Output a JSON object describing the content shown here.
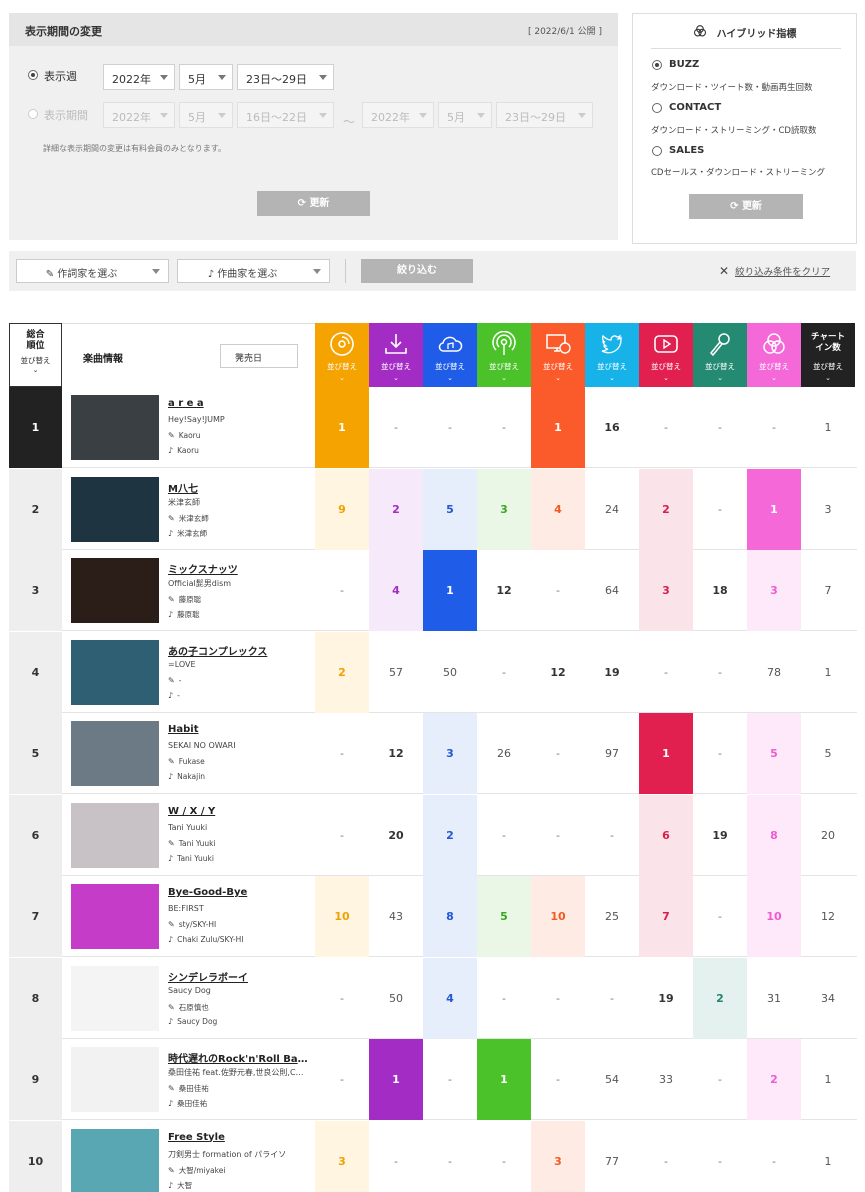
{
  "period": {
    "title": "表示期間の変更",
    "published": "[ 2022/6/1 公開 ]",
    "week_option_label": "表示週",
    "week": {
      "year": "2022年",
      "month": "5月",
      "range": "23日～29日"
    },
    "period_option_label": "表示期間",
    "range_from": {
      "year": "2022年",
      "month": "5月",
      "range": "16日～22日"
    },
    "range_sep": "～",
    "range_to": {
      "year": "2022年",
      "month": "5月",
      "range": "23日～29日"
    },
    "note": "詳細な表示期間の変更は有料会員のみとなります。",
    "update_label": "更新",
    "update_icon": "refresh-icon"
  },
  "hybrid": {
    "title": "ハイブリッド指標",
    "options": [
      {
        "label": "BUZZ",
        "desc": "ダウンロード・ツイート数・動画再生回数",
        "selected": true
      },
      {
        "label": "CONTACT",
        "desc": "ダウンロード・ストリーミング・CD読取数",
        "selected": false
      },
      {
        "label": "SALES",
        "desc": "CDセールス・ダウンロード・ストリーミング",
        "selected": false
      }
    ],
    "update_label": "更新"
  },
  "filter": {
    "lyricist_placeholder": "作詞家を選ぶ",
    "composer_placeholder": "作曲家を選ぶ",
    "apply_label": "絞り込む",
    "clear_label": "絞り込み条件をクリア"
  },
  "table": {
    "rank_header": "総合\n順位",
    "sort_label": "並び替え",
    "info_header": "楽曲情報",
    "release_sort": "発売日",
    "chart_in_header": "チャート\nイン数",
    "metrics": [
      {
        "key": "cd",
        "icon": "cd-icon",
        "color": "#f5a300",
        "light": "#fff5e0",
        "text": "#f0a000"
      },
      {
        "key": "download",
        "icon": "download-icon",
        "color": "#a32cc4",
        "light": "#f6e9f9",
        "text": "#a32cc4"
      },
      {
        "key": "streaming",
        "icon": "cloud-music-icon",
        "color": "#1f5de8",
        "light": "#e6eefc",
        "text": "#2456d8"
      },
      {
        "key": "radio",
        "icon": "radio-icon",
        "color": "#4cc22a",
        "light": "#eaf7e6",
        "text": "#3aa81e"
      },
      {
        "key": "pc",
        "icon": "pc-read-icon",
        "color": "#fb5a2a",
        "light": "#fdebe4",
        "text": "#f05a25"
      },
      {
        "key": "twitter",
        "icon": "twitter-icon",
        "color": "#17b3e8",
        "light": "#ffffff",
        "text": "#444444"
      },
      {
        "key": "youtube",
        "icon": "youtube-icon",
        "color": "#e2204f",
        "light": "#fbe3ea",
        "text": "#d81f4a"
      },
      {
        "key": "karaoke",
        "icon": "microphone-icon",
        "color": "#258a72",
        "light": "#e5f1ee",
        "text": "#238570"
      },
      {
        "key": "lookup",
        "icon": "hybrid-icon",
        "color": "#f468d8",
        "light": "#fde9f9",
        "text": "#ee5cd0"
      },
      {
        "key": "chartin",
        "icon": "",
        "color": "#222222",
        "light": "#ffffff",
        "text": "#555555"
      }
    ],
    "rows": [
      {
        "rank": "1",
        "title": "a r e a",
        "artist": "Hey!Say!JUMP",
        "lyricist": "Kaoru",
        "composer": "Kaoru",
        "cells": [
          "1",
          "-",
          "-",
          "-",
          "1",
          "16",
          "-",
          "-",
          "-",
          "1"
        ],
        "styles": [
          "S",
          "N",
          "N",
          "N",
          "S",
          "B",
          "N",
          "N",
          "N",
          "N"
        ],
        "thumb": "#3a3f44"
      },
      {
        "rank": "2",
        "title": "M八七",
        "artist": "米津玄師",
        "lyricist": "米津玄師",
        "composer": "米津玄師",
        "cells": [
          "9",
          "2",
          "5",
          "3",
          "4",
          "24",
          "2",
          "-",
          "1",
          "3"
        ],
        "styles": [
          "L",
          "L",
          "L",
          "L",
          "L",
          "N",
          "L",
          "N",
          "S",
          "N"
        ],
        "thumb": "#1e3440"
      },
      {
        "rank": "3",
        "title": "ミックスナッツ",
        "artist": "Official髭男dism",
        "lyricist": "藤原聡",
        "composer": "藤原聡",
        "cells": [
          "-",
          "4",
          "1",
          "12",
          "-",
          "64",
          "3",
          "18",
          "3",
          "7"
        ],
        "styles": [
          "N",
          "L",
          "S",
          "B",
          "N",
          "N",
          "L",
          "B",
          "L",
          "N"
        ],
        "thumb": "#2b1d18"
      },
      {
        "rank": "4",
        "title": "あの子コンプレックス",
        "artist": "=LOVE",
        "lyricist": "-",
        "composer": "-",
        "cells": [
          "2",
          "57",
          "50",
          "-",
          "12",
          "19",
          "-",
          "-",
          "78",
          "1"
        ],
        "styles": [
          "L",
          "N",
          "N",
          "N",
          "B",
          "B",
          "N",
          "N",
          "N",
          "N"
        ],
        "thumb": "#2f5f73"
      },
      {
        "rank": "5",
        "title": "Habit",
        "artist": "SEKAI NO OWARI",
        "lyricist": "Fukase",
        "composer": "Nakajin",
        "cells": [
          "-",
          "12",
          "3",
          "26",
          "-",
          "97",
          "1",
          "-",
          "5",
          "5"
        ],
        "styles": [
          "N",
          "B",
          "L",
          "N",
          "N",
          "N",
          "S",
          "N",
          "L",
          "N"
        ],
        "thumb": "#6c7a86"
      },
      {
        "rank": "6",
        "title": "W / X / Y",
        "artist": "Tani Yuuki",
        "lyricist": "Tani Yuuki",
        "composer": "Tani Yuuki",
        "cells": [
          "-",
          "20",
          "2",
          "-",
          "-",
          "-",
          "6",
          "19",
          "8",
          "20"
        ],
        "styles": [
          "N",
          "B",
          "L",
          "N",
          "N",
          "N",
          "L",
          "B",
          "L",
          "N"
        ],
        "thumb": "#c8c2c6"
      },
      {
        "rank": "7",
        "title": "Bye-Good-Bye",
        "artist": "BE:FIRST",
        "lyricist": "sty/SKY-HI",
        "composer": "Chaki Zulu/SKY-HI",
        "cells": [
          "10",
          "43",
          "8",
          "5",
          "10",
          "25",
          "7",
          "-",
          "10",
          "12"
        ],
        "styles": [
          "L",
          "N",
          "L",
          "L",
          "L",
          "N",
          "L",
          "N",
          "L",
          "N"
        ],
        "thumb": "#c43cc8"
      },
      {
        "rank": "8",
        "title": "シンデレラボーイ",
        "artist": "Saucy Dog",
        "lyricist": "石原慎也",
        "composer": "Saucy Dog",
        "cells": [
          "-",
          "50",
          "4",
          "-",
          "-",
          "-",
          "19",
          "2",
          "31",
          "34"
        ],
        "styles": [
          "N",
          "N",
          "L",
          "N",
          "N",
          "N",
          "B",
          "L",
          "N",
          "N"
        ],
        "thumb": "#f4f4f4"
      },
      {
        "rank": "9",
        "title": "時代遅れのRock'n'Roll Band",
        "artist": "桑田佳祐 feat.佐野元春,世良公則,Char,野口五郎",
        "lyricist": "桑田佳祐",
        "composer": "桑田佳祐",
        "cells": [
          "-",
          "1",
          "-",
          "1",
          "-",
          "54",
          "33",
          "-",
          "2",
          "1"
        ],
        "styles": [
          "N",
          "S",
          "N",
          "S",
          "N",
          "N",
          "N",
          "N",
          "L",
          "N"
        ],
        "thumb": "#f2f2f2"
      },
      {
        "rank": "10",
        "title": "Free Style",
        "artist": "刀剣男士 formation of パライソ",
        "lyricist": "大智/miyakei",
        "composer": "大智",
        "cells": [
          "3",
          "-",
          "-",
          "-",
          "3",
          "77",
          "-",
          "-",
          "-",
          "1"
        ],
        "styles": [
          "L",
          "N",
          "N",
          "N",
          "L",
          "N",
          "N",
          "N",
          "N",
          "N"
        ],
        "thumb": "#5aa7b4"
      }
    ]
  }
}
